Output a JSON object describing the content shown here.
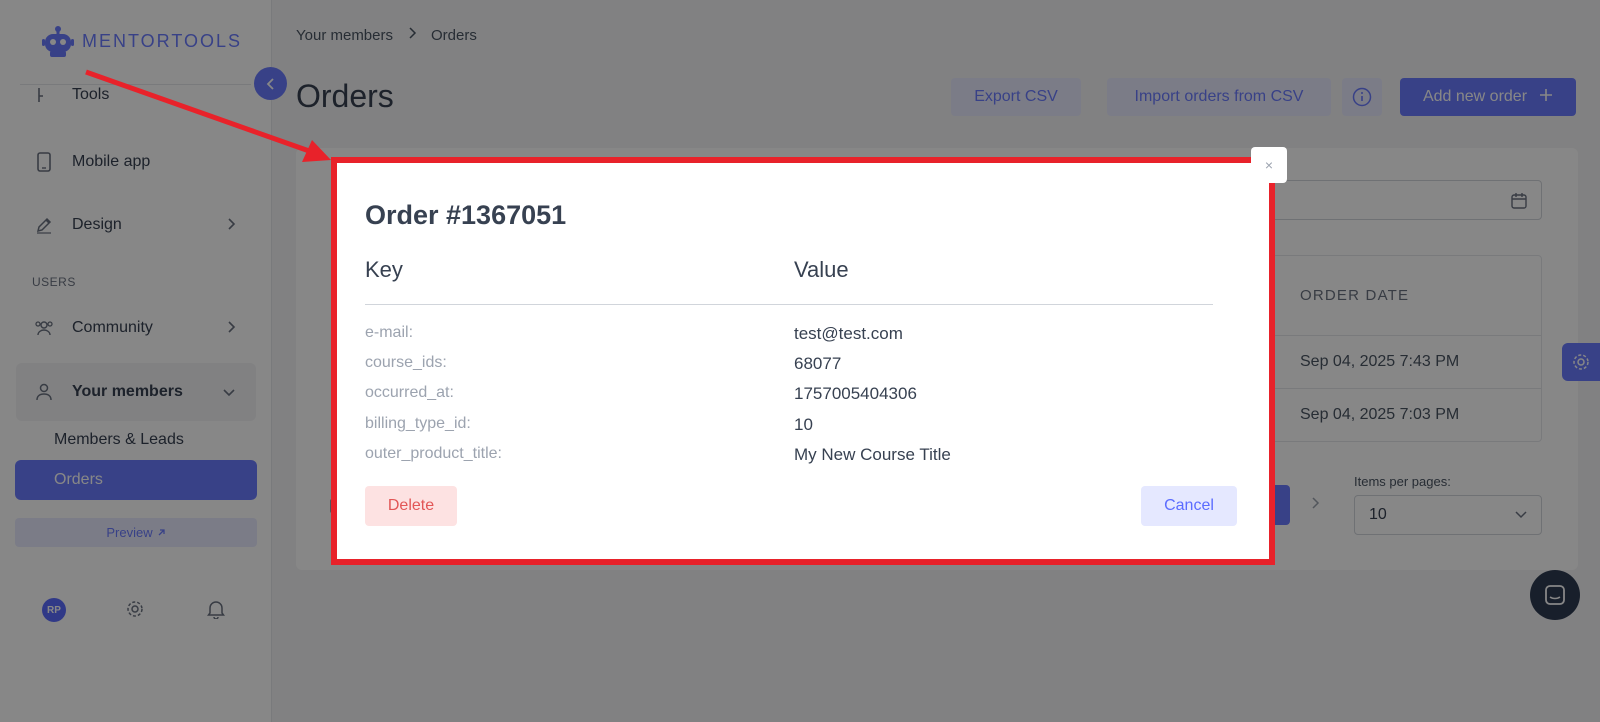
{
  "app": {
    "logo_text": "MENTORTOOLS"
  },
  "sidebar": {
    "items": [
      {
        "label": "Tools",
        "icon": "tools-icon"
      },
      {
        "label": "Mobile app",
        "icon": "mobile-icon"
      },
      {
        "label": "Design",
        "icon": "pencil-icon"
      }
    ],
    "section_label": "USERS",
    "community_label": "Community",
    "your_members_label": "Your members",
    "sub_items": [
      {
        "label": "Members & Leads"
      },
      {
        "label": "Orders"
      }
    ],
    "preview_label": "Preview",
    "avatar_initials": "RP"
  },
  "breadcrumb": {
    "parent": "Your members",
    "current": "Orders"
  },
  "page": {
    "title": "Orders"
  },
  "toolbar": {
    "export_label": "Export CSV",
    "import_label": "Import orders from CSV",
    "add_label": "Add new order"
  },
  "table": {
    "header_order_date": "ORDER DATE",
    "rows": [
      {
        "order_date": "Sep 04, 2025 7:43 PM"
      },
      {
        "order_date": "Sep 04, 2025 7:03 PM"
      }
    ]
  },
  "pagination": {
    "items_per_page_label": "Items per pages:",
    "items_per_page_value": "10"
  },
  "modal": {
    "title": "Order #1367051",
    "key_header": "Key",
    "value_header": "Value",
    "fields": [
      {
        "key": "e-mail:",
        "value": "test@test.com"
      },
      {
        "key": "course_ids:",
        "value": "68077"
      },
      {
        "key": "occurred_at:",
        "value": "1757005404306"
      },
      {
        "key": "billing_type_id:",
        "value": "10"
      },
      {
        "key": "outer_product_title:",
        "value": "My New Course Title"
      }
    ],
    "delete_label": "Delete",
    "cancel_label": "Cancel",
    "close_symbol": "×"
  },
  "colors": {
    "accent": "#6b7bff",
    "annotation": "#e8222a",
    "danger": "#e25656"
  }
}
